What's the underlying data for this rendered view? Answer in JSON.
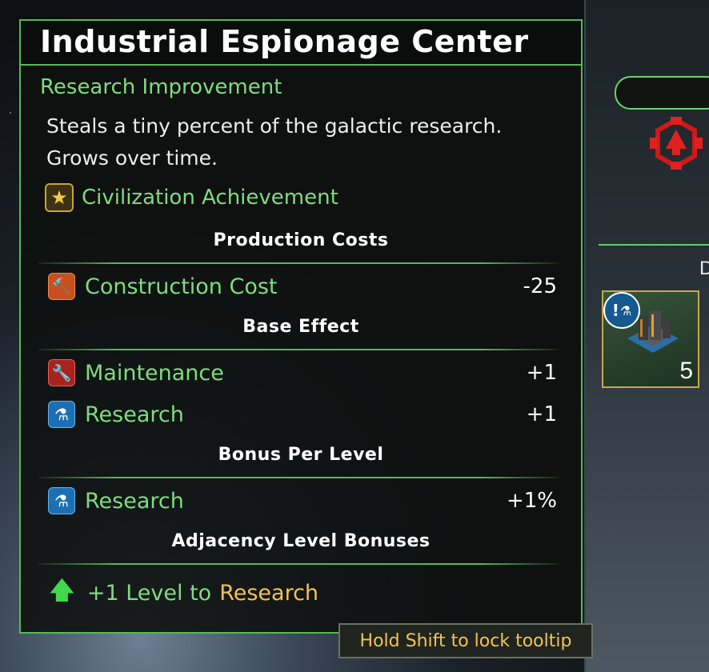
{
  "tooltip": {
    "title": "Industrial Espionage Center",
    "subtitle": "Research Improvement",
    "description": "Steals a tiny percent of the galactic research. Grows over time.",
    "achievement": {
      "icon": "star-icon",
      "label": "Civilization Achievement"
    },
    "sections": {
      "production_costs": "Production Costs",
      "base_effect": "Base Effect",
      "bonus_per_level": "Bonus Per Level",
      "adjacency": "Adjacency Level Bonuses"
    },
    "production_rows": [
      {
        "icon": "hammer-icon",
        "label": "Construction Cost",
        "value": "-25"
      }
    ],
    "base_rows": [
      {
        "icon": "wrench-icon",
        "label": "Maintenance",
        "value": "+1"
      },
      {
        "icon": "flask-icon",
        "label": "Research",
        "value": "+1"
      }
    ],
    "bonus_rows": [
      {
        "icon": "flask-icon",
        "label": "Research",
        "value": "+1%"
      }
    ],
    "adjacency_bonus": {
      "icon": "green-up-arrow-icon",
      "text": "+1 Level to",
      "highlight": "Research"
    }
  },
  "hint": "Hold Shift to lock tooltip",
  "side_panel": {
    "header_letter": "D",
    "card": {
      "badge": "!",
      "count": "5"
    }
  },
  "colors": {
    "accent_green": "#56b957",
    "label_green": "#7fdc7f",
    "highlight_gold": "#f3c351",
    "card_border": "#c9a64e"
  }
}
